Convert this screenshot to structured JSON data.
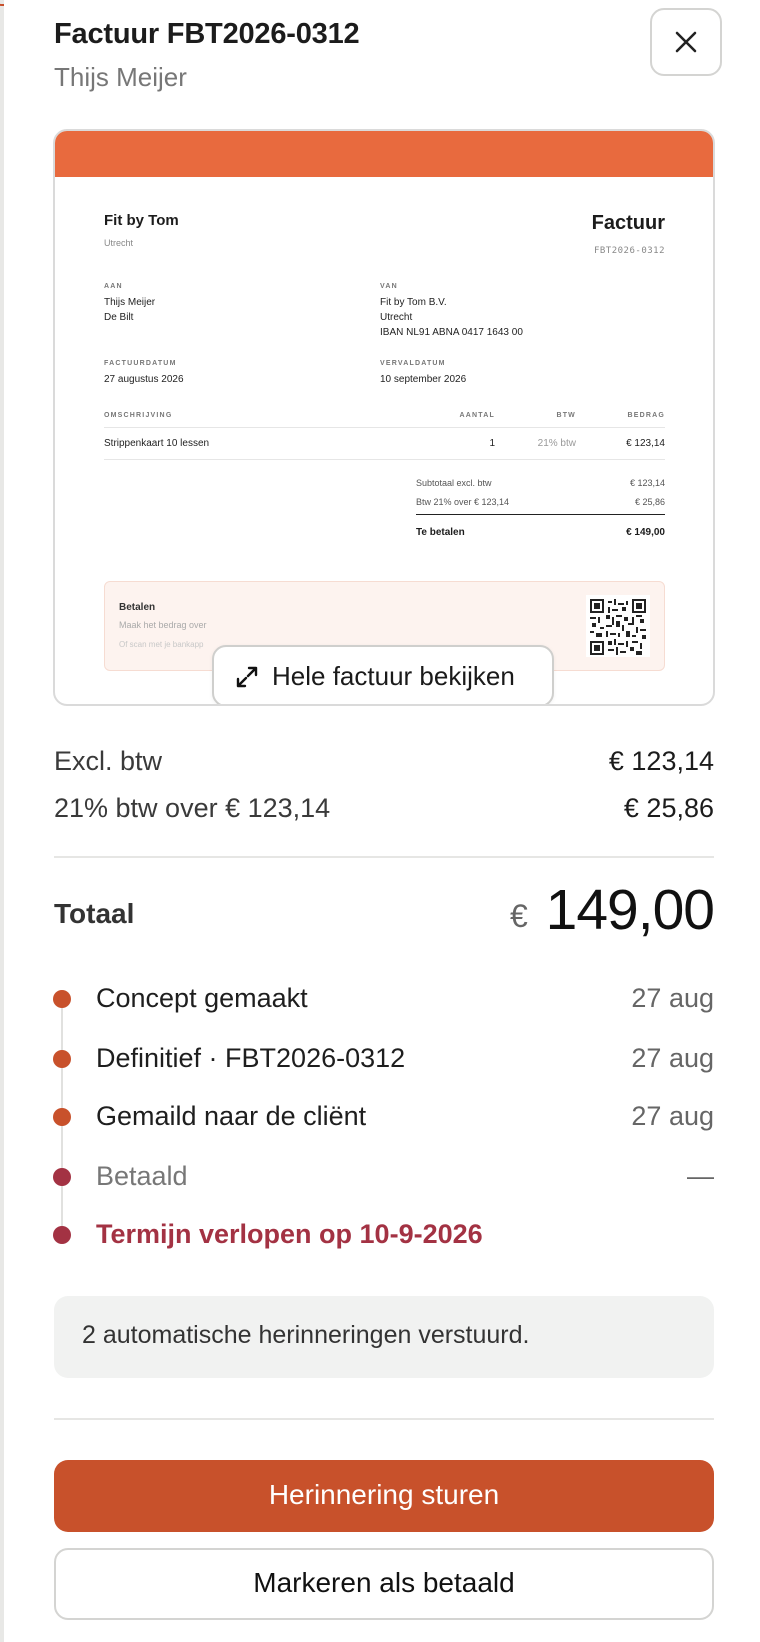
{
  "header": {
    "title": "Factuur FBT2026-0312",
    "client": "Thijs Meijer"
  },
  "colors": {
    "accent": "#c8512b",
    "band": "#e86a3e",
    "done": "#c8512b",
    "overdue": "#a33243"
  },
  "preview": {
    "company": "Fit by Tom",
    "company_city": "Utrecht",
    "doc_word": "Factuur",
    "doc_number": "FBT2026-0312",
    "to": {
      "label": "AAN",
      "lines": [
        "Thijs Meijer",
        "De Bilt"
      ]
    },
    "from": {
      "label": "VAN",
      "lines": [
        "Fit by Tom B.V.",
        "Utrecht",
        "IBAN NL91 ABNA 0417 1643 00"
      ]
    },
    "invoice_date": {
      "label": "FACTUURDATUM",
      "value": "27 augustus 2026"
    },
    "due_date": {
      "label": "VERVALDATUM",
      "value": "10 september 2026"
    },
    "columns": {
      "description": "OMSCHRIJVING",
      "qty": "AANTAL",
      "vat": "BTW",
      "amount": "BEDRAG"
    },
    "line": {
      "description": "Strippenkaart 10 lessen",
      "qty": "1",
      "vat": "21% btw",
      "amount": "€ 123,14"
    },
    "subtotal": {
      "label": "Subtotaal excl. btw",
      "value": "€ 123,14"
    },
    "vat_line": {
      "label": "Btw 21% over € 123,14",
      "value": "€ 25,86"
    },
    "due": {
      "label": "Te betalen",
      "value": "€ 149,00"
    },
    "pay": {
      "title": "Betalen",
      "line1": "Maak het bedrag over",
      "line2": "Of scan met je bankapp"
    },
    "view_button": "Hele factuur bekijken"
  },
  "summary": {
    "excl_label": "Excl. btw",
    "excl_value": "€ 123,14",
    "vat_label": "21% btw over € 123,14",
    "vat_value": "€ 25,86",
    "total_label": "Totaal",
    "total_currency": "€",
    "total_value": "149,00"
  },
  "timeline": [
    {
      "label": "Concept gemaakt",
      "date": "27 aug",
      "state": "done"
    },
    {
      "label": "Definitief · FBT2026-0312",
      "date": "27 aug",
      "state": "done"
    },
    {
      "label": "Gemaild naar de cliënt",
      "date": "27 aug",
      "state": "done"
    },
    {
      "label": "Betaald",
      "date": "—",
      "state": "pending"
    },
    {
      "label": "Termijn verlopen op 10-9-2026",
      "date": "",
      "state": "overdue"
    }
  ],
  "info": "2 automatische herinneringen verstuurd.",
  "actions": {
    "primary": "Herinnering sturen",
    "secondary": "Markeren als betaald"
  }
}
